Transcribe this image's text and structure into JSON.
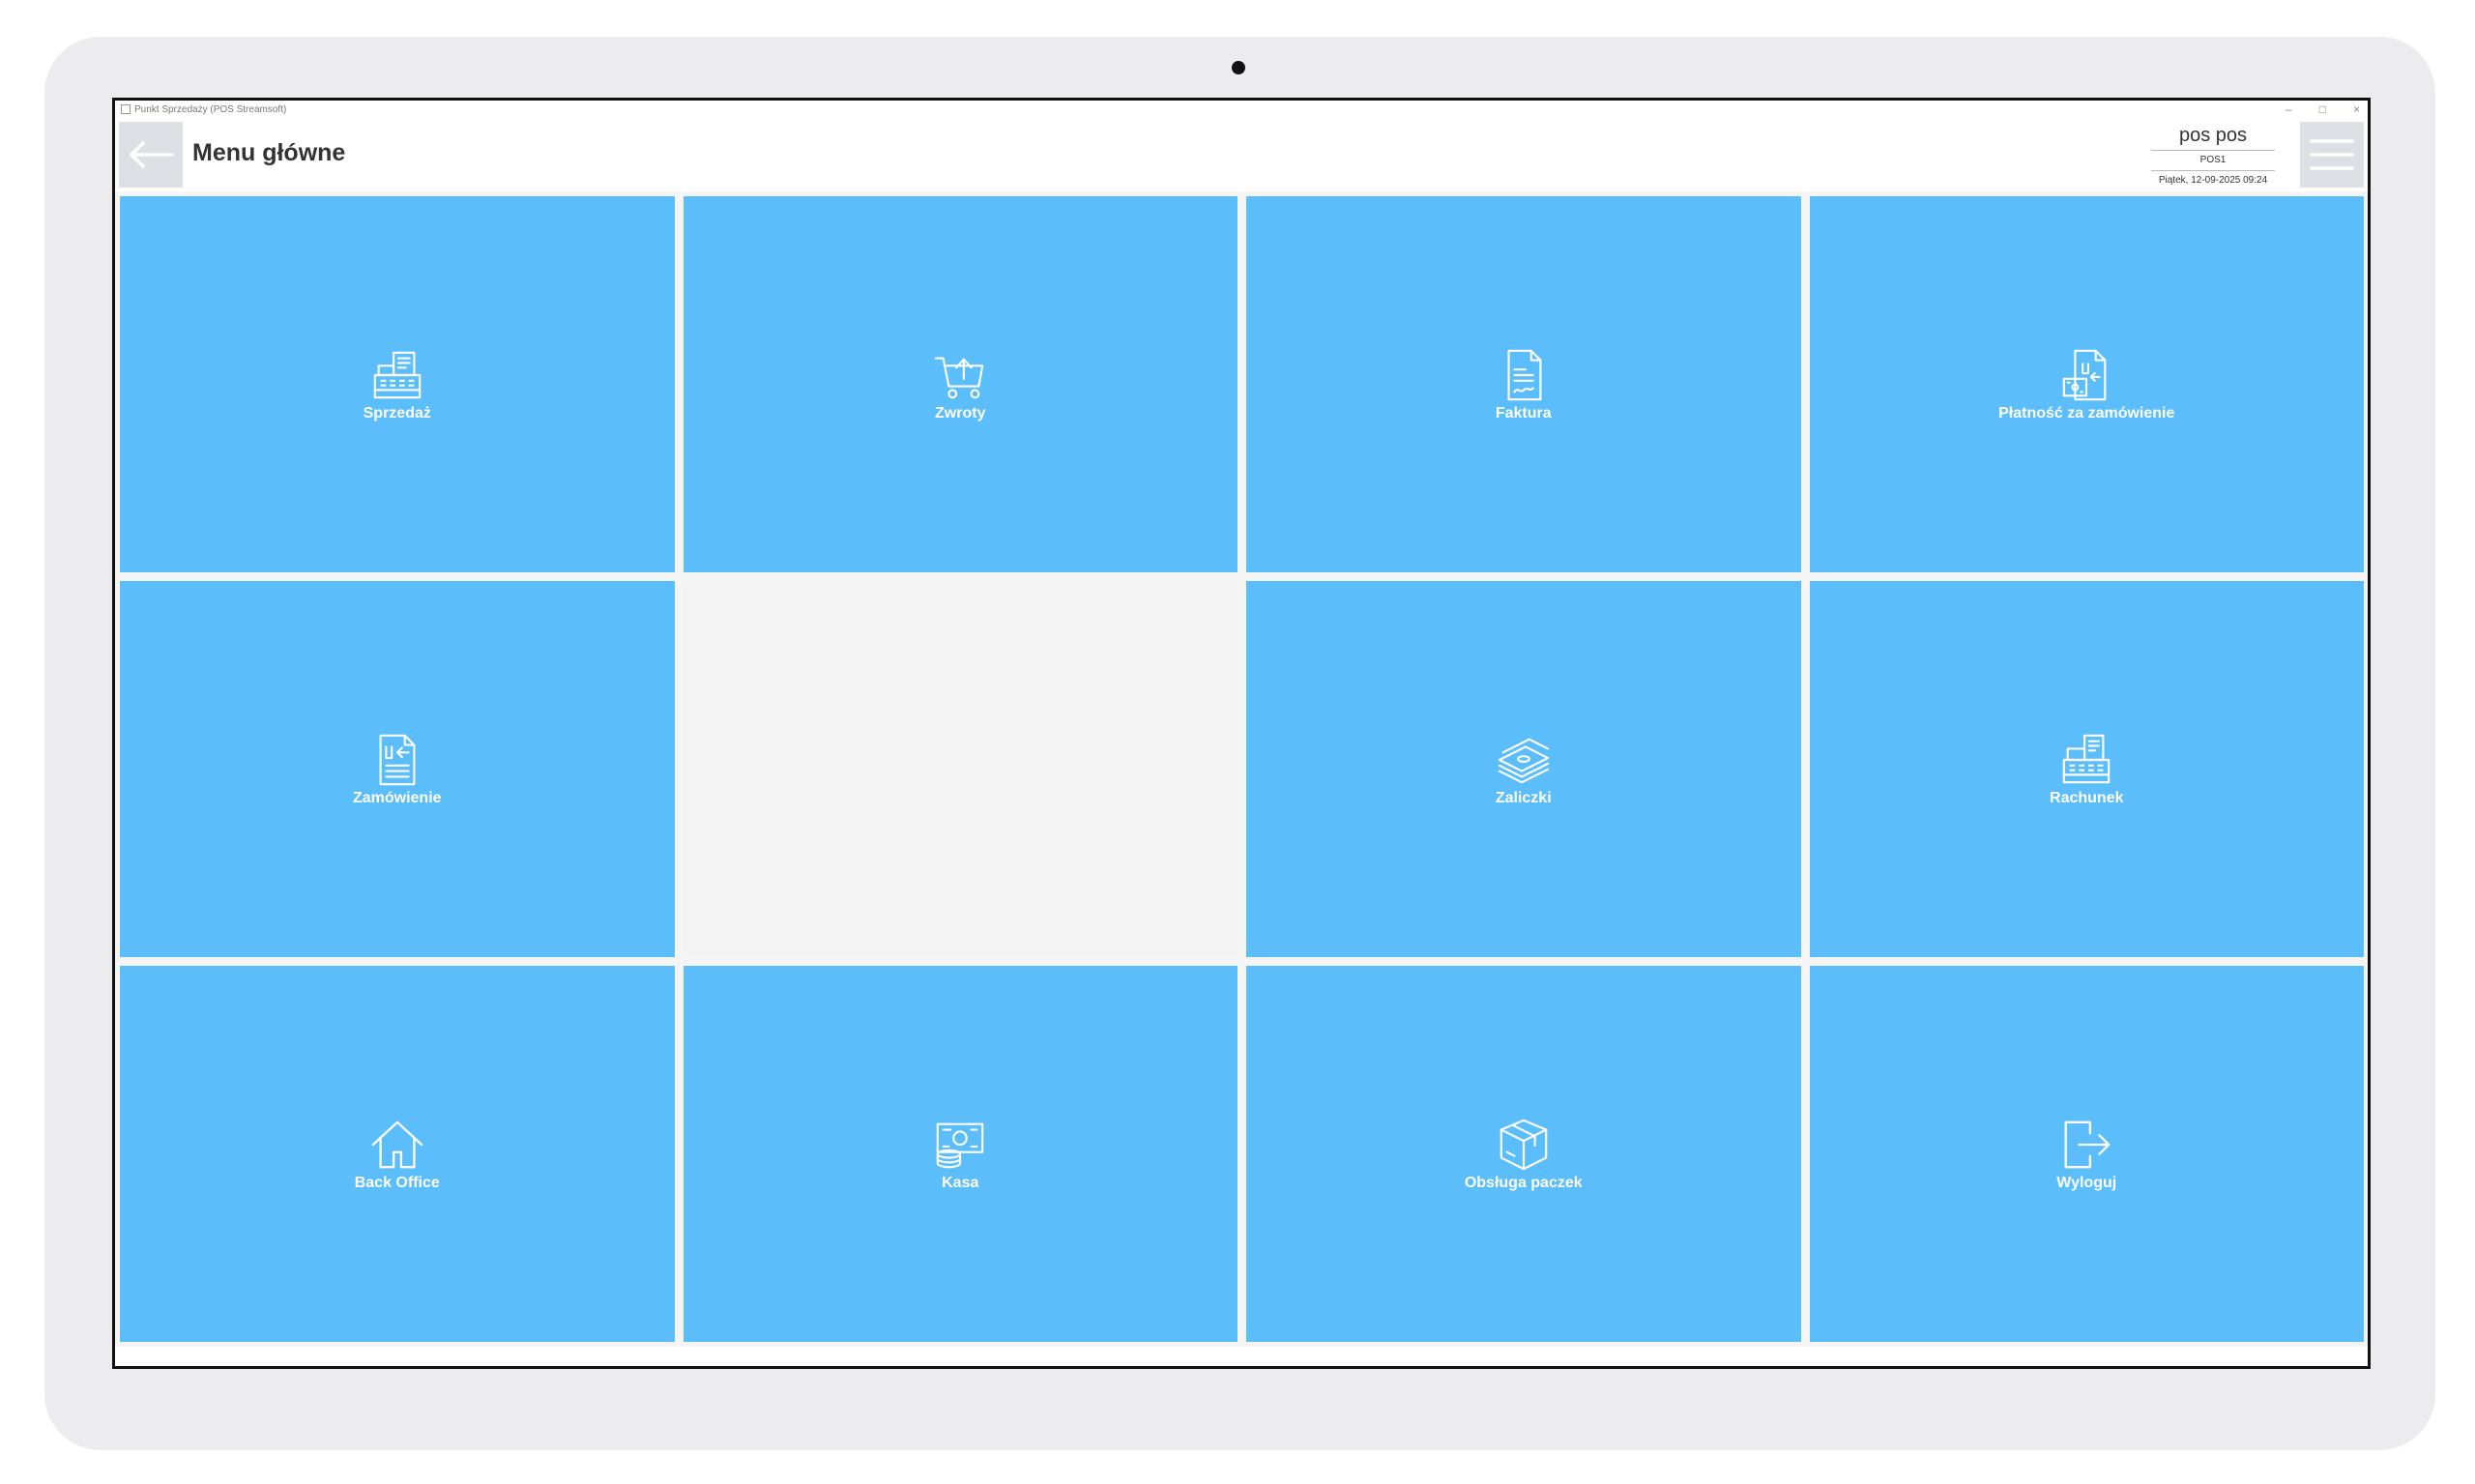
{
  "window": {
    "title": "Punkt Sprzedaży (POS Streamsoft)",
    "controls": [
      "–",
      "□",
      "×"
    ]
  },
  "header": {
    "back_icon": "arrow-left-icon",
    "title": "Menu główne",
    "user": {
      "name": "pos pos",
      "station": "POS1",
      "datetime": "Piątek, 12-09-2025 09:24"
    },
    "menu_icon": "hamburger-icon"
  },
  "colors": {
    "tile": "#5bbefb",
    "background": "#f5f5f5",
    "header_button": "#dde1e5"
  },
  "tiles": [
    {
      "label": "Sprzedaż",
      "icon": "cash-register-icon"
    },
    {
      "label": "Zwroty",
      "icon": "cart-return-icon"
    },
    {
      "label": "Faktura",
      "icon": "invoice-icon"
    },
    {
      "label": "Płatność za zamówienie",
      "icon": "order-payment-icon"
    },
    {
      "label": "Zamówienie",
      "icon": "order-document-icon"
    },
    {
      "label": "",
      "icon": ""
    },
    {
      "label": "Zaliczki",
      "icon": "money-stack-icon"
    },
    {
      "label": "Rachunek",
      "icon": "receipt-register-icon"
    },
    {
      "label": "Back Office",
      "icon": "home-icon"
    },
    {
      "label": "Kasa",
      "icon": "cash-drawer-icon"
    },
    {
      "label": "Obsługa paczek",
      "icon": "package-icon"
    },
    {
      "label": "Wyloguj",
      "icon": "logout-icon"
    }
  ]
}
